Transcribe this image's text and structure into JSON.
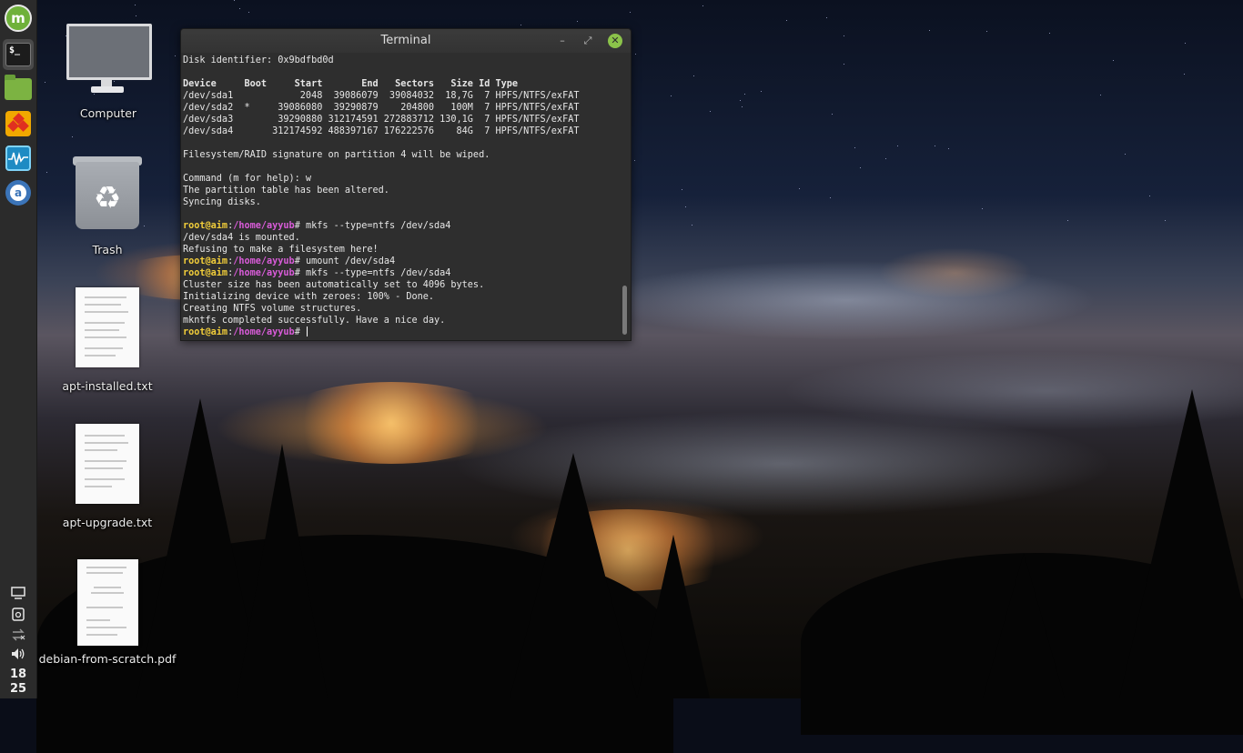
{
  "desktop": {
    "icons": [
      {
        "label": "Computer"
      },
      {
        "label": "Trash"
      },
      {
        "label": "apt-installed.txt"
      },
      {
        "label": "apt-upgrade.txt"
      },
      {
        "label": "debian-from-scratch.pdf"
      }
    ]
  },
  "panel": {
    "launchers": [
      {
        "name": "mint-menu-icon"
      },
      {
        "name": "terminal-icon",
        "glyph": "$_"
      },
      {
        "name": "files-folder-icon"
      },
      {
        "name": "diamond-app-icon"
      },
      {
        "name": "system-monitor-icon"
      },
      {
        "name": "a-app-icon",
        "glyph": "a"
      }
    ],
    "tray": [
      {
        "name": "display-icon"
      },
      {
        "name": "clipboard-icon"
      },
      {
        "name": "network-icon"
      },
      {
        "name": "volume-icon"
      }
    ],
    "clock": {
      "hour": "18",
      "minute": "25"
    }
  },
  "terminal": {
    "title": "Terminal",
    "buttons": {
      "minimize": "–",
      "maximize": "⤢",
      "close": "✕"
    },
    "lines": [
      {
        "text": "Disk identifier: 0x9bdfbd0d"
      },
      {
        "text": ""
      },
      {
        "text": "Device     Boot     Start       End   Sectors   Size Id Type",
        "bold": true
      },
      {
        "text": "/dev/sda1            2048  39086079  39084032  18,7G  7 HPFS/NTFS/exFAT"
      },
      {
        "text": "/dev/sda2  *     39086080  39290879    204800   100M  7 HPFS/NTFS/exFAT"
      },
      {
        "text": "/dev/sda3        39290880 312174591 272883712 130,1G  7 HPFS/NTFS/exFAT"
      },
      {
        "text": "/dev/sda4       312174592 488397167 176222576    84G  7 HPFS/NTFS/exFAT"
      },
      {
        "text": ""
      },
      {
        "text": "Filesystem/RAID signature on partition 4 will be wiped."
      },
      {
        "text": ""
      },
      {
        "text": "Command (m for help): w"
      },
      {
        "text": "The partition table has been altered."
      },
      {
        "text": "Syncing disks."
      },
      {
        "text": ""
      },
      {
        "prompt": true,
        "user": "root@aim",
        "sep": ":",
        "path": "/home/ayyub",
        "cmd": "# mkfs --type=ntfs /dev/sda4"
      },
      {
        "text": "/dev/sda4 is mounted."
      },
      {
        "text": "Refusing to make a filesystem here!"
      },
      {
        "prompt": true,
        "user": "root@aim",
        "sep": ":",
        "path": "/home/ayyub",
        "cmd": "# umount /dev/sda4"
      },
      {
        "prompt": true,
        "user": "root@aim",
        "sep": ":",
        "path": "/home/ayyub",
        "cmd": "# mkfs --type=ntfs /dev/sda4"
      },
      {
        "text": "Cluster size has been automatically set to 4096 bytes."
      },
      {
        "text": "Initializing device with zeroes: 100% - Done."
      },
      {
        "text": "Creating NTFS volume structures."
      },
      {
        "text": "mkntfs completed successfully. Have a nice day."
      },
      {
        "prompt": true,
        "user": "root@aim",
        "sep": ":",
        "path": "/home/ayyub",
        "cmd": "# ",
        "cursor": true
      }
    ]
  },
  "colors": {
    "prompt_user": "#f2ce3a",
    "prompt_path": "#d95cd9",
    "close_button": "#8bc34a"
  }
}
